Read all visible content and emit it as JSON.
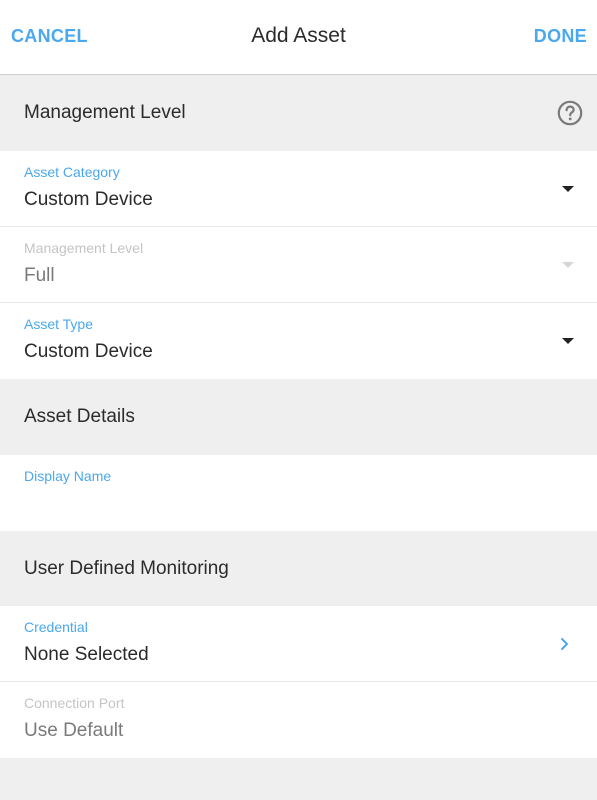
{
  "header": {
    "cancel_label": "CANCEL",
    "title": "Add Asset",
    "done_label": "DONE"
  },
  "sections": {
    "management": {
      "title": "Management Level"
    },
    "details": {
      "title": "Asset Details"
    },
    "monitoring": {
      "title": "User Defined Monitoring"
    }
  },
  "fields": {
    "asset_category": {
      "label": "Asset Category",
      "value": "Custom Device"
    },
    "management_level": {
      "label": "Management Level",
      "value": "Full"
    },
    "asset_type": {
      "label": "Asset Type",
      "value": "Custom Device"
    },
    "display_name": {
      "label": "Display Name",
      "value": ""
    },
    "credential": {
      "label": "Credential",
      "value": "None Selected"
    },
    "connection_port": {
      "label": "Connection Port",
      "value": "Use Default"
    }
  },
  "icons": {
    "help": "help-circle-icon",
    "dropdown": "caret-down-icon",
    "chevron": "chevron-right-icon"
  },
  "colors": {
    "accent": "#4aa8ee",
    "section_bg": "#efefef",
    "disabled_text": "#c4c4c4"
  }
}
